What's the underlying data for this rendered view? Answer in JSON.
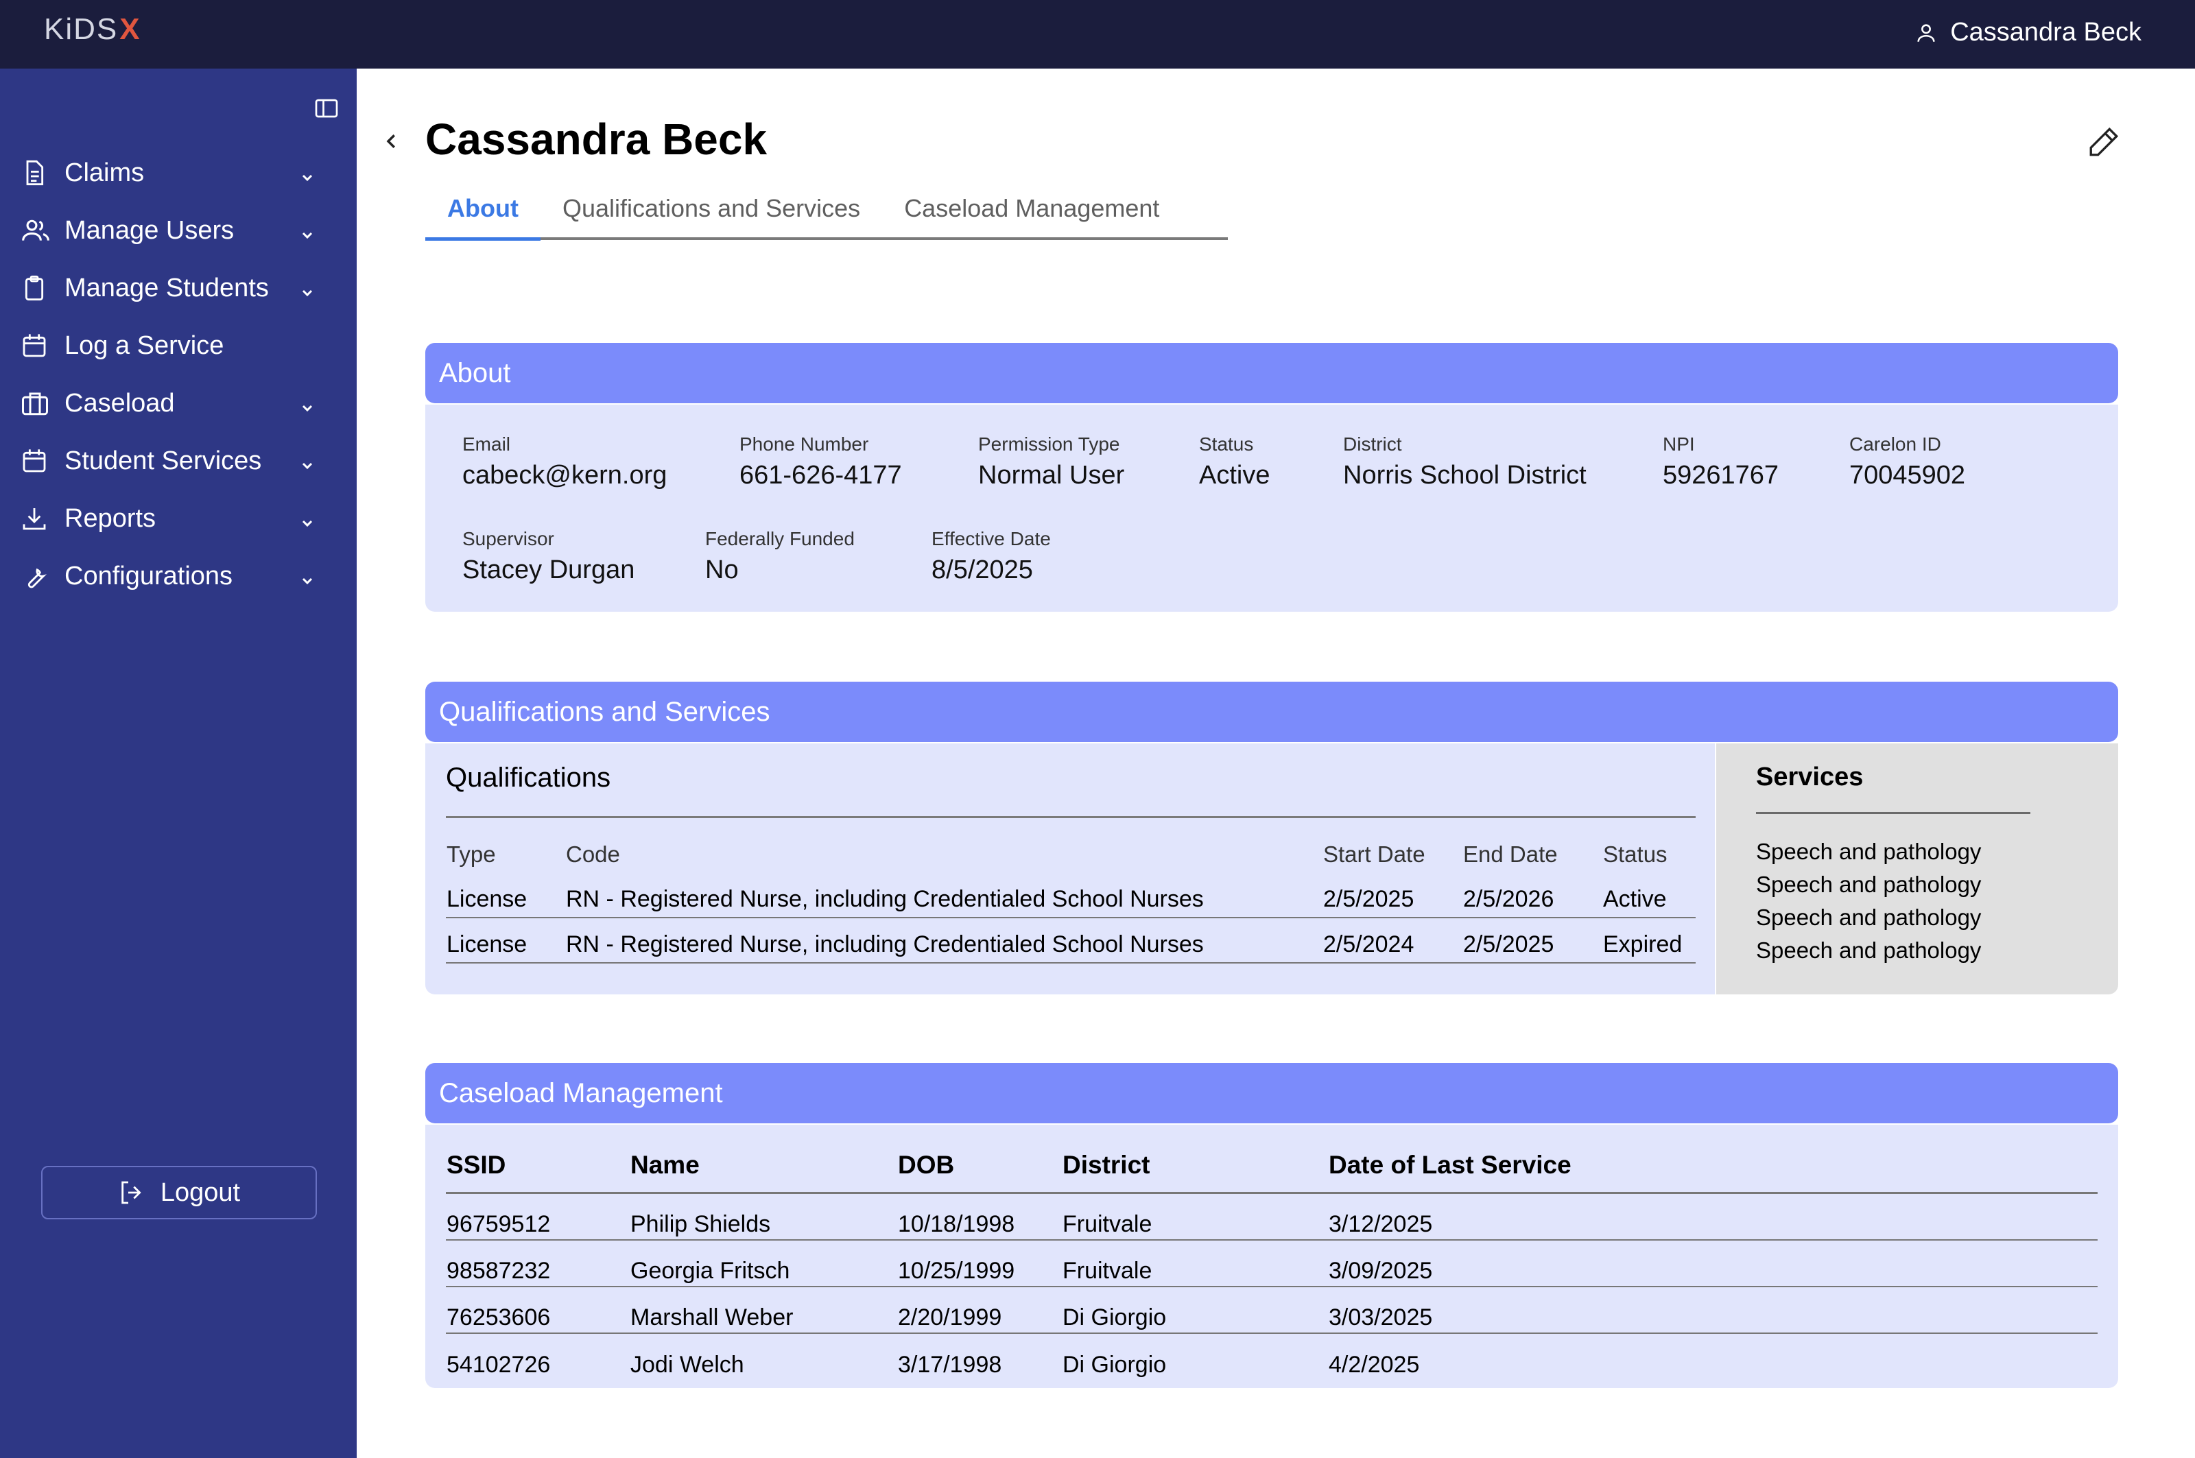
{
  "app": {
    "logo_text": "KiDS",
    "logo_mark": "X",
    "current_user": "Cassandra Beck"
  },
  "sidebar": {
    "items": [
      {
        "label": "Claims",
        "icon": "document-icon",
        "expandable": true
      },
      {
        "label": "Manage Users",
        "icon": "users-icon",
        "expandable": true
      },
      {
        "label": "Manage Students",
        "icon": "clipboard-icon",
        "expandable": true
      },
      {
        "label": "Log a Service",
        "icon": "calendar-icon",
        "expandable": false
      },
      {
        "label": "Caseload",
        "icon": "briefcase-icon",
        "expandable": true
      },
      {
        "label": "Student Services",
        "icon": "calendar-icon",
        "expandable": true
      },
      {
        "label": "Reports",
        "icon": "download-icon",
        "expandable": true
      },
      {
        "label": "Configurations",
        "icon": "wrench-icon",
        "expandable": true
      }
    ],
    "logout_label": "Logout"
  },
  "page": {
    "title": "Cassandra Beck",
    "tabs": [
      {
        "label": "About",
        "active": true
      },
      {
        "label": "Qualifications and Services",
        "active": false
      },
      {
        "label": "Caseload Management",
        "active": false
      }
    ]
  },
  "about": {
    "heading": "About",
    "fields": [
      {
        "label": "Email",
        "value": "cabeck@kern.org"
      },
      {
        "label": "Phone Number",
        "value": "661-626-4177"
      },
      {
        "label": "Permission Type",
        "value": "Normal User"
      },
      {
        "label": "Status",
        "value": "Active"
      },
      {
        "label": "District",
        "value": "Norris School District"
      },
      {
        "label": "NPI",
        "value": "59261767"
      },
      {
        "label": "Carelon ID",
        "value": "70045902"
      },
      {
        "label": "Supervisor",
        "value": "Stacey Durgan"
      },
      {
        "label": "Federally Funded",
        "value": "No"
      },
      {
        "label": "Effective Date",
        "value": "8/5/2025"
      }
    ]
  },
  "qualifications_services": {
    "heading": "Qualifications and Services",
    "qualifications": {
      "heading": "Qualifications",
      "columns": [
        "Type",
        "Code",
        "Start Date",
        "End Date",
        "Status"
      ],
      "rows": [
        [
          "License",
          "RN - Registered Nurse, including Credentialed School Nurses",
          "2/5/2025",
          "2/5/2026",
          "Active"
        ],
        [
          "License",
          "RN - Registered Nurse, including Credentialed School Nurses",
          "2/5/2024",
          "2/5/2025",
          "Expired"
        ]
      ]
    },
    "services": {
      "heading": "Services",
      "items": [
        "Speech and pathology",
        "Speech and pathology",
        "Speech and pathology",
        "Speech and pathology"
      ]
    }
  },
  "caseload": {
    "heading": "Caseload Management",
    "columns": [
      "SSID",
      "Name",
      "DOB",
      "District",
      "Date of Last Service"
    ],
    "rows": [
      [
        "96759512",
        "Philip Shields",
        "10/18/1998",
        "Fruitvale",
        "3/12/2025"
      ],
      [
        "98587232",
        "Georgia Fritsch",
        "10/25/1999",
        "Fruitvale",
        "3/09/2025"
      ],
      [
        "76253606",
        "Marshall Weber",
        "2/20/1999",
        "Di Giorgio",
        "3/03/2025"
      ],
      [
        "54102726",
        "Jodi Welch",
        "3/17/1998",
        "Di Giorgio",
        "4/2/2025"
      ]
    ]
  },
  "colors": {
    "topbar": "#1b1d3d",
    "sidebar": "#2e3785",
    "section_header": "#7b8bfb",
    "section_body": "#e1e5fc",
    "services_panel": "#e0e0e0",
    "active_tab": "#3b79e4"
  }
}
